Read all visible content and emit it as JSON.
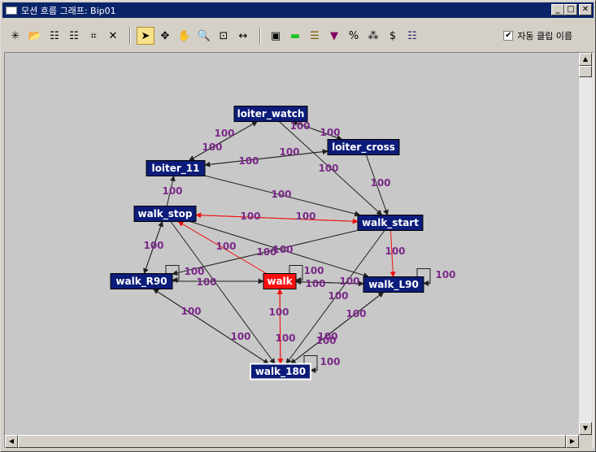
{
  "window": {
    "title": "모션 흐름 그래프: Bip01",
    "minimize_glyph": "_",
    "maximize_glyph": "□",
    "close_glyph": "✕"
  },
  "toolbar": {
    "groups": [
      [
        {
          "name": "new-state-icon",
          "glyph": "✳"
        },
        {
          "name": "open-file-icon",
          "glyph": "📂"
        },
        {
          "name": "script-icon",
          "glyph": "☷"
        },
        {
          "name": "script-alt-icon",
          "glyph": "☷"
        },
        {
          "name": "transition-icon",
          "glyph": "⌗"
        },
        {
          "name": "delete-icon",
          "glyph": "✕"
        }
      ],
      [
        {
          "name": "select-arrow-icon",
          "glyph": "➤",
          "active": true
        },
        {
          "name": "move-icon",
          "glyph": "✥"
        },
        {
          "name": "pan-hand-icon",
          "glyph": "✋"
        },
        {
          "name": "zoom-icon",
          "glyph": "🔍"
        },
        {
          "name": "zoom-region-icon",
          "glyph": "⊡"
        },
        {
          "name": "zoom-extents-icon",
          "glyph": "↔"
        }
      ],
      [
        {
          "name": "save-clip-icon",
          "glyph": "▣"
        },
        {
          "name": "set-random-icon",
          "glyph": "▬"
        },
        {
          "name": "properties-icon",
          "glyph": "☰"
        },
        {
          "name": "select-random-icon",
          "glyph": "▼"
        },
        {
          "name": "percent-icon",
          "glyph": "%"
        },
        {
          "name": "optimize-icon",
          "glyph": "⁂"
        },
        {
          "name": "dollar-icon",
          "glyph": "$"
        },
        {
          "name": "clip-properties-icon",
          "glyph": "☷"
        }
      ]
    ],
    "auto_clean": {
      "label": "자동 클립 이름",
      "checked": true,
      "check_glyph": "✔"
    }
  },
  "colors": {
    "node_fill": "#0c1c7a",
    "node_active_fill": "#ff1010",
    "edge_dark": "#202020",
    "edge_red": "#ee1010",
    "edge_label": "#7a2a88",
    "canvas": "#c8c8c8"
  },
  "graph": {
    "nodes": [
      {
        "id": "loiter_watch",
        "label": "loiter_watch"
      },
      {
        "id": "loiter_cross",
        "label": "loiter_cross"
      },
      {
        "id": "loiter_11",
        "label": "loiter_11"
      },
      {
        "id": "walk_stop",
        "label": "walk_stop"
      },
      {
        "id": "walk_start",
        "label": "walk_start"
      },
      {
        "id": "walk_R90",
        "label": "walk_R90"
      },
      {
        "id": "walk",
        "label": "walk",
        "active": true
      },
      {
        "id": "walk_L90",
        "label": "walk_L90"
      },
      {
        "id": "walk_180",
        "label": "walk_180",
        "selected": true
      }
    ],
    "edges": [
      {
        "from": "loiter_watch",
        "to": "loiter_11",
        "label": "100"
      },
      {
        "from": "loiter_11",
        "to": "loiter_watch",
        "label": "100"
      },
      {
        "from": "loiter_watch",
        "to": "loiter_cross",
        "label": "100"
      },
      {
        "from": "loiter_watch",
        "to": "walk_start",
        "label": "100"
      },
      {
        "from": "loiter_cross",
        "to": "loiter_11",
        "label": "100"
      },
      {
        "from": "loiter_11",
        "to": "loiter_cross",
        "label": "100"
      },
      {
        "from": "loiter_cross",
        "to": "walk_start",
        "label": "100"
      },
      {
        "from": "loiter_cross",
        "to": "loiter_watch",
        "label": "100"
      },
      {
        "from": "loiter_11",
        "to": "walk_start",
        "label": "100"
      },
      {
        "from": "walk_stop",
        "to": "loiter_11",
        "label": "100"
      },
      {
        "from": "walk_start",
        "to": "walk_stop",
        "label": "100",
        "red": true
      },
      {
        "from": "walk_stop",
        "to": "walk_start",
        "label": "100",
        "red": true
      },
      {
        "from": "walk_stop",
        "to": "walk_R90",
        "label": "100"
      },
      {
        "from": "walk",
        "to": "walk_stop",
        "label": "100",
        "red": true
      },
      {
        "from": "walk_start",
        "to": "walk_L90",
        "label": "100",
        "red": true
      },
      {
        "from": "walk_start",
        "to": "walk_R90",
        "label": "100"
      },
      {
        "from": "walk_stop",
        "to": "walk_L90",
        "label": "100"
      },
      {
        "from": "walk_R90",
        "to": "walk",
        "label": "100"
      },
      {
        "from": "walk_R90",
        "to": "walk_stop",
        "label": "100"
      },
      {
        "from": "walk",
        "to": "walk_L90",
        "label": "100"
      },
      {
        "from": "walk_L90",
        "to": "walk",
        "label": "100"
      },
      {
        "from": "walk",
        "to": "walk",
        "label": "100"
      },
      {
        "from": "walk_R90",
        "to": "walk_180",
        "label": "100"
      },
      {
        "from": "walk_180",
        "to": "walk_R90",
        "label": "100"
      },
      {
        "from": "walk",
        "to": "walk_180",
        "label": "100",
        "red": true
      },
      {
        "from": "walk_180",
        "to": "walk",
        "label": "100",
        "red": true
      },
      {
        "from": "walk_L90",
        "to": "walk_180",
        "label": "100"
      },
      {
        "from": "walk_180",
        "to": "walk_L90",
        "label": "100"
      },
      {
        "from": "walk_stop",
        "to": "walk_180",
        "label": "100"
      },
      {
        "from": "walk_start",
        "to": "walk_180",
        "label": "100"
      },
      {
        "from": "walk_L90",
        "to": "walk_L90",
        "label": "100"
      },
      {
        "from": "walk_180",
        "to": "walk_180",
        "label": "100"
      },
      {
        "from": "walk_R90",
        "to": "walk_R90",
        "label": "100"
      }
    ]
  },
  "scrollbars": {
    "up": "▲",
    "down": "▼",
    "left": "◀",
    "right": "▶"
  }
}
